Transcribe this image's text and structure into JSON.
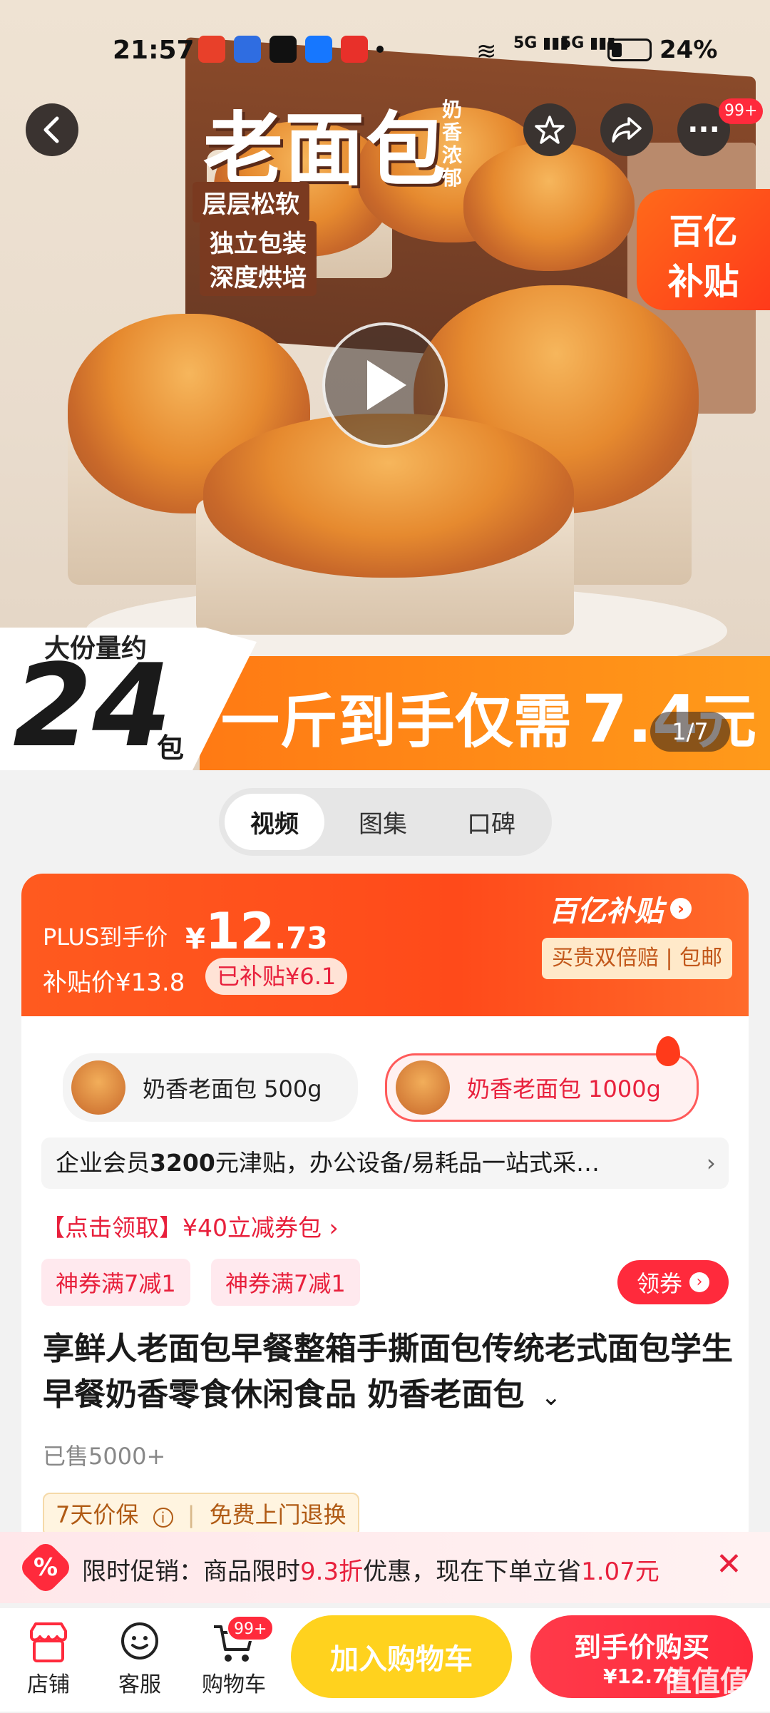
{
  "status": {
    "time": "21:57",
    "net1": "5G",
    "net2": "5G",
    "battery": "24%"
  },
  "header": {
    "badge": "99+"
  },
  "hero": {
    "product_title": "老面包",
    "vertical_tag": "奶香浓郁",
    "features": [
      "层层松软",
      "独立包装",
      "深度烘培"
    ],
    "subsidy_logo_top": "百亿",
    "subsidy_logo_bottom": "补贴",
    "amount_label": "大份量约",
    "amount_number": "24",
    "amount_unit": "包",
    "banner_text": "一斤到手仅需",
    "banner_price": "7.4",
    "banner_unit": "元",
    "page_indicator": "1/7"
  },
  "media_tabs": [
    {
      "label": "视频"
    },
    {
      "label": "图集"
    },
    {
      "label": "口碑"
    }
  ],
  "price": {
    "plus_label": "PLUS到手价",
    "currency": "¥",
    "main": "12",
    "decimal": ".73",
    "subsidy_label": "补贴价¥13.8",
    "subsidized": "已补贴¥6.1",
    "brand": "百亿补贴",
    "guarantee": "买贵双倍赔 | 包邮"
  },
  "variants": [
    {
      "label": "奶香老面包 500g",
      "selected": false
    },
    {
      "label": "奶香老面包 1000g",
      "selected": true
    }
  ],
  "enterprise": {
    "prefix": "企业会员",
    "amount": "3200",
    "rest": "元津贴，办公设备/易耗品一站式采…",
    "arrow": "›"
  },
  "coupon_pack": "【点击领取】¥40立减券包 ›",
  "coupons": [
    "神券满7减1",
    "神券满7减1"
  ],
  "claim_button": "领券",
  "product_title": "享鲜人老面包早餐整箱手撕面包传统老式面包学生早餐奶香零食休闲食品 奶香老面包",
  "sold": "已售5000+",
  "services": {
    "price_protect": "7天价保",
    "return": "免费上门退换"
  },
  "promo": {
    "prefix": "限时促销：商品限时",
    "discount": "9.3折",
    "middle": "优惠，现在下单立省",
    "save": "1.07元"
  },
  "bottom_nav": [
    {
      "label": "店铺"
    },
    {
      "label": "客服"
    },
    {
      "label": "购物车",
      "badge": "99+"
    }
  ],
  "buttons": {
    "add_cart": "加入购物车",
    "buy": "到手价购买",
    "buy_price": "¥12.73"
  },
  "watermark": "值值值",
  "watermark_url": "zhizhizhi.com",
  "colors": {
    "accent": "#ff3b1f",
    "yellow": "#ffd21e",
    "pink_red": "#ff2a3c"
  }
}
